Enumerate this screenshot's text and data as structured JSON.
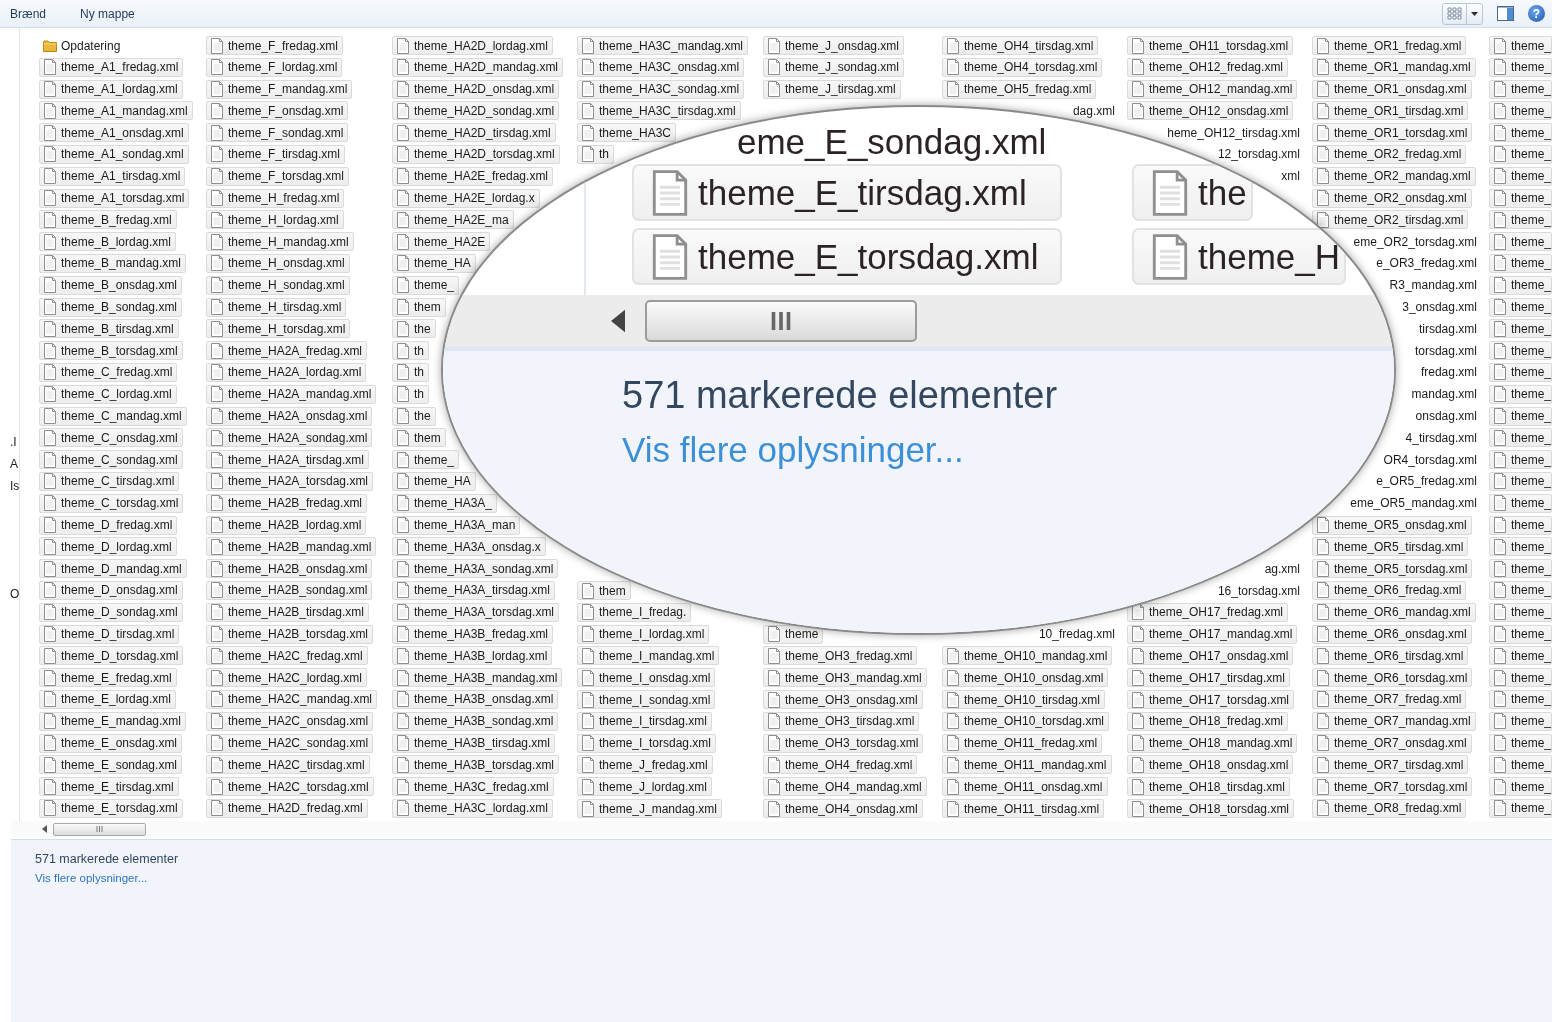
{
  "toolbar": {
    "buttons": [
      "Brænd",
      "Ny mappe"
    ],
    "help": "?"
  },
  "nav_pane": {
    "fragments": [
      ".I",
      "A",
      "Is",
      "O"
    ]
  },
  "columns": [
    {
      "top": [
        {
          "kind": "folder",
          "names": [
            "Opdatering"
          ]
        },
        {
          "kind": "file",
          "names": [
            "theme_A1_fredag.xml",
            "theme_A1_lordag.xml",
            "theme_A1_mandag.xml",
            "theme_A1_onsdag.xml",
            "theme_A1_sondag.xml",
            "theme_A1_tirsdag.xml",
            "theme_A1_torsdag.xml",
            "theme_B_fredag.xml",
            "theme_B_lordag.xml",
            "theme_B_mandag.xml",
            "theme_B_onsdag.xml",
            "theme_B_sondag.xml",
            "theme_B_tirsdag.xml",
            "theme_B_torsdag.xml",
            "theme_C_fredag.xml",
            "theme_C_lordag.xml",
            "theme_C_mandag.xml",
            "theme_C_onsdag.xml",
            "theme_C_sondag.xml",
            "theme_C_tirsdag.xml",
            "theme_C_torsdag.xml",
            "theme_D_fredag.xml",
            "theme_D_lordag.xml",
            "theme_D_mandag.xml",
            "theme_D_onsdag.xml",
            "theme_D_sondag.xml",
            "theme_D_tirsdag.xml",
            "theme_D_torsdag.xml",
            "theme_E_fredag.xml",
            "theme_E_lordag.xml",
            "theme_E_mandag.xml",
            "theme_E_onsdag.xml",
            "theme_E_sondag.xml",
            "theme_E_tirsdag.xml",
            "theme_E_torsdag.xml"
          ]
        }
      ]
    },
    {
      "top": [
        {
          "kind": "file",
          "names": [
            "theme_F_fredag.xml",
            "theme_F_lordag.xml",
            "theme_F_mandag.xml",
            "theme_F_onsdag.xml",
            "theme_F_sondag.xml",
            "theme_F_tirsdag.xml",
            "theme_F_torsdag.xml",
            "theme_H_fredag.xml",
            "theme_H_lordag.xml",
            "theme_H_mandag.xml",
            "theme_H_onsdag.xml",
            "theme_H_sondag.xml",
            "theme_H_tirsdag.xml",
            "theme_H_torsdag.xml",
            "theme_HA2A_fredag.xml",
            "theme_HA2A_lordag.xml",
            "theme_HA2A_mandag.xml",
            "theme_HA2A_onsdag.xml",
            "theme_HA2A_sondag.xml",
            "theme_HA2A_tirsdag.xml",
            "theme_HA2A_torsdag.xml",
            "theme_HA2B_fredag.xml",
            "theme_HA2B_lordag.xml",
            "theme_HA2B_mandag.xml",
            "theme_HA2B_onsdag.xml",
            "theme_HA2B_sondag.xml",
            "theme_HA2B_tirsdag.xml",
            "theme_HA2B_torsdag.xml",
            "theme_HA2C_fredag.xml",
            "theme_HA2C_lordag.xml",
            "theme_HA2C_mandag.xml",
            "theme_HA2C_onsdag.xml",
            "theme_HA2C_sondag.xml",
            "theme_HA2C_tirsdag.xml",
            "theme_HA2C_torsdag.xml",
            "theme_HA2D_fredag.xml"
          ]
        }
      ]
    },
    {
      "top": [
        {
          "kind": "file",
          "names": [
            "theme_HA2D_lordag.xml",
            "theme_HA2D_mandag.xml",
            "theme_HA2D_onsdag.xml",
            "theme_HA2D_sondag.xml",
            "theme_HA2D_tirsdag.xml",
            "theme_HA2D_torsdag.xml",
            "theme_HA2E_fredag.xml",
            "theme_HA2E_lordag.x",
            "theme_HA2E_ma",
            "theme_HA2E",
            "theme_HA",
            "theme_",
            "them",
            "the",
            "th",
            "th",
            "th",
            "the",
            "them",
            "theme_",
            "theme_HA",
            "theme_HA3A_",
            "theme_HA3A_man",
            "theme_HA3A_onsdag.x",
            "theme_HA3A_sondag.xml",
            "theme_HA3A_tirsdag.xml",
            "theme_HA3A_torsdag.xml",
            "theme_HA3B_fredag.xml",
            "theme_HA3B_lordag.xml",
            "theme_HA3B_mandag.xml",
            "theme_HA3B_onsdag.xml",
            "theme_HA3B_sondag.xml",
            "theme_HA3B_tirsdag.xml",
            "theme_HA3B_torsdag.xml",
            "theme_HA3C_fredag.xml",
            "theme_HA3C_lordag.xml"
          ]
        }
      ]
    },
    {
      "top": [
        {
          "kind": "file",
          "names": [
            "theme_HA3C_mandag.xml",
            "theme_HA3C_onsdag.xml",
            "theme_HA3C_sondag.xml",
            "theme_HA3C_tirsdag.xml",
            "theme_HA3C",
            "th"
          ]
        }
      ],
      "bottom": [
        {
          "kind": "file",
          "names": [
            "them",
            "theme_I_fredag.",
            "theme_I_lordag.xml",
            "theme_I_mandag.xml",
            "theme_I_onsdag.xml",
            "theme_I_sondag.xml",
            "theme_I_tirsdag.xml",
            "theme_I_torsdag.xml",
            "theme_J_fredag.xml",
            "theme_J_lordag.xml",
            "theme_J_mandag.xml"
          ]
        }
      ]
    },
    {
      "top": [
        {
          "kind": "file",
          "names": [
            "theme_J_onsdag.xml",
            "theme_J_sondag.xml",
            "theme_J_tirsdag.xml"
          ]
        }
      ],
      "bottom": [
        {
          "kind": "file",
          "names": [
            "theme",
            "theme_OH3_fredag.xml",
            "theme_OH3_mandag.xml",
            "theme_OH3_onsdag.xml",
            "theme_OH3_tirsdag.xml",
            "theme_OH3_torsdag.xml",
            "theme_OH4_fredag.xml",
            "theme_OH4_mandag.xml",
            "theme_OH4_onsdag.xml"
          ]
        }
      ]
    },
    {
      "top": [
        {
          "kind": "file",
          "names": [
            "theme_OH4_tirsdag.xml",
            "theme_OH4_torsdag.xml",
            "theme_OH5_fredag.xml"
          ]
        },
        {
          "kind": "tail",
          "names": [
            "dag.xml"
          ]
        }
      ],
      "bottom": [
        {
          "kind": "tail",
          "names": [
            "10_fredag.xml"
          ]
        },
        {
          "kind": "file",
          "names": [
            "theme_OH10_mandag.xml",
            "theme_OH10_onsdag.xml",
            "theme_OH10_tirsdag.xml",
            "theme_OH10_torsdag.xml",
            "theme_OH11_fredag.xml",
            "theme_OH11_mandag.xml",
            "theme_OH11_onsdag.xml",
            "theme_OH11_tirsdag.xml"
          ]
        }
      ]
    },
    {
      "top": [
        {
          "kind": "file",
          "names": [
            "theme_OH11_torsdag.xml",
            "theme_OH12_fredag.xml",
            "theme_OH12_mandag.xml",
            "theme_OH12_onsdag.xml"
          ]
        },
        {
          "kind": "tail",
          "names": [
            "heme_OH12_tirsdag.xml",
            "12_torsdag.xml",
            "xml"
          ]
        }
      ],
      "bottom": [
        {
          "kind": "tail",
          "names": [
            "ag.xml",
            "16_torsdag.xml"
          ]
        },
        {
          "kind": "file",
          "names": [
            "theme_OH17_fredag.xml",
            "theme_OH17_mandag.xml",
            "theme_OH17_onsdag.xml",
            "theme_OH17_tirsdag.xml",
            "theme_OH17_torsdag.xml",
            "theme_OH18_fredag.xml",
            "theme_OH18_mandag.xml",
            "theme_OH18_onsdag.xml",
            "theme_OH18_tirsdag.xml",
            "theme_OH18_torsdag.xml"
          ]
        }
      ]
    },
    {
      "top": [
        {
          "kind": "file",
          "names": [
            "theme_OR1_fredag.xml",
            "theme_OR1_mandag.xml",
            "theme_OR1_onsdag.xml",
            "theme_OR1_tirsdag.xml",
            "theme_OR1_torsdag.xml",
            "theme_OR2_fredag.xml",
            "theme_OR2_mandag.xml",
            "theme_OR2_onsdag.xml",
            "theme_OR2_tirsdag.xml"
          ]
        },
        {
          "kind": "tail",
          "names": [
            "eme_OR2_torsdag.xml",
            "e_OR3_fredag.xml",
            "R3_mandag.xml",
            "3_onsdag.xml",
            "tirsdag.xml",
            "torsdag.xml",
            "fredag.xml",
            "mandag.xml",
            "onsdag.xml",
            "4_tirsdag.xml",
            "OR4_torsdag.xml",
            "e_OR5_fredag.xml",
            "eme_OR5_mandag.xml"
          ]
        },
        {
          "kind": "file",
          "names": [
            "theme_OR5_onsdag.xml",
            "theme_OR5_tirsdag.xml",
            "theme_OR5_torsdag.xml",
            "theme_OR6_fredag.xml",
            "theme_OR6_mandag.xml",
            "theme_OR6_onsdag.xml",
            "theme_OR6_tirsdag.xml",
            "theme_OR6_torsdag.xml",
            "theme_OR7_fredag.xml",
            "theme_OR7_mandag.xml",
            "theme_OR7_onsdag.xml",
            "theme_OR7_tirsdag.xml",
            "theme_OR7_torsdag.xml",
            "theme_OR8_fredag.xml"
          ]
        }
      ]
    },
    {
      "top": [
        {
          "kind": "file",
          "names": [
            "theme_",
            "theme_",
            "theme_",
            "theme_",
            "theme_",
            "theme_",
            "theme_",
            "theme_",
            "theme_",
            "theme_",
            "theme_",
            "theme_",
            "theme_",
            "theme_",
            "theme_",
            "theme_",
            "theme_",
            "theme_",
            "theme_",
            "theme_",
            "theme_",
            "theme_",
            "theme_",
            "theme_",
            "theme_",
            "theme_",
            "theme_",
            "theme_",
            "theme_",
            "theme_",
            "theme_",
            "theme_",
            "theme_",
            "theme_",
            "theme_",
            "theme_"
          ]
        }
      ]
    }
  ],
  "details": {
    "count": "571 markerede elementer",
    "link": "Vis flere oplysninger..."
  },
  "magnifier": {
    "rows": [
      [
        "eme_E_sondag.xml"
      ],
      [
        "theme_E_tirsdag.xml",
        "the"
      ],
      [
        "theme_E_torsdag.xml",
        "theme_H"
      ]
    ],
    "count": "571 markerede elementer",
    "link": "Vis flere oplysninger..."
  }
}
